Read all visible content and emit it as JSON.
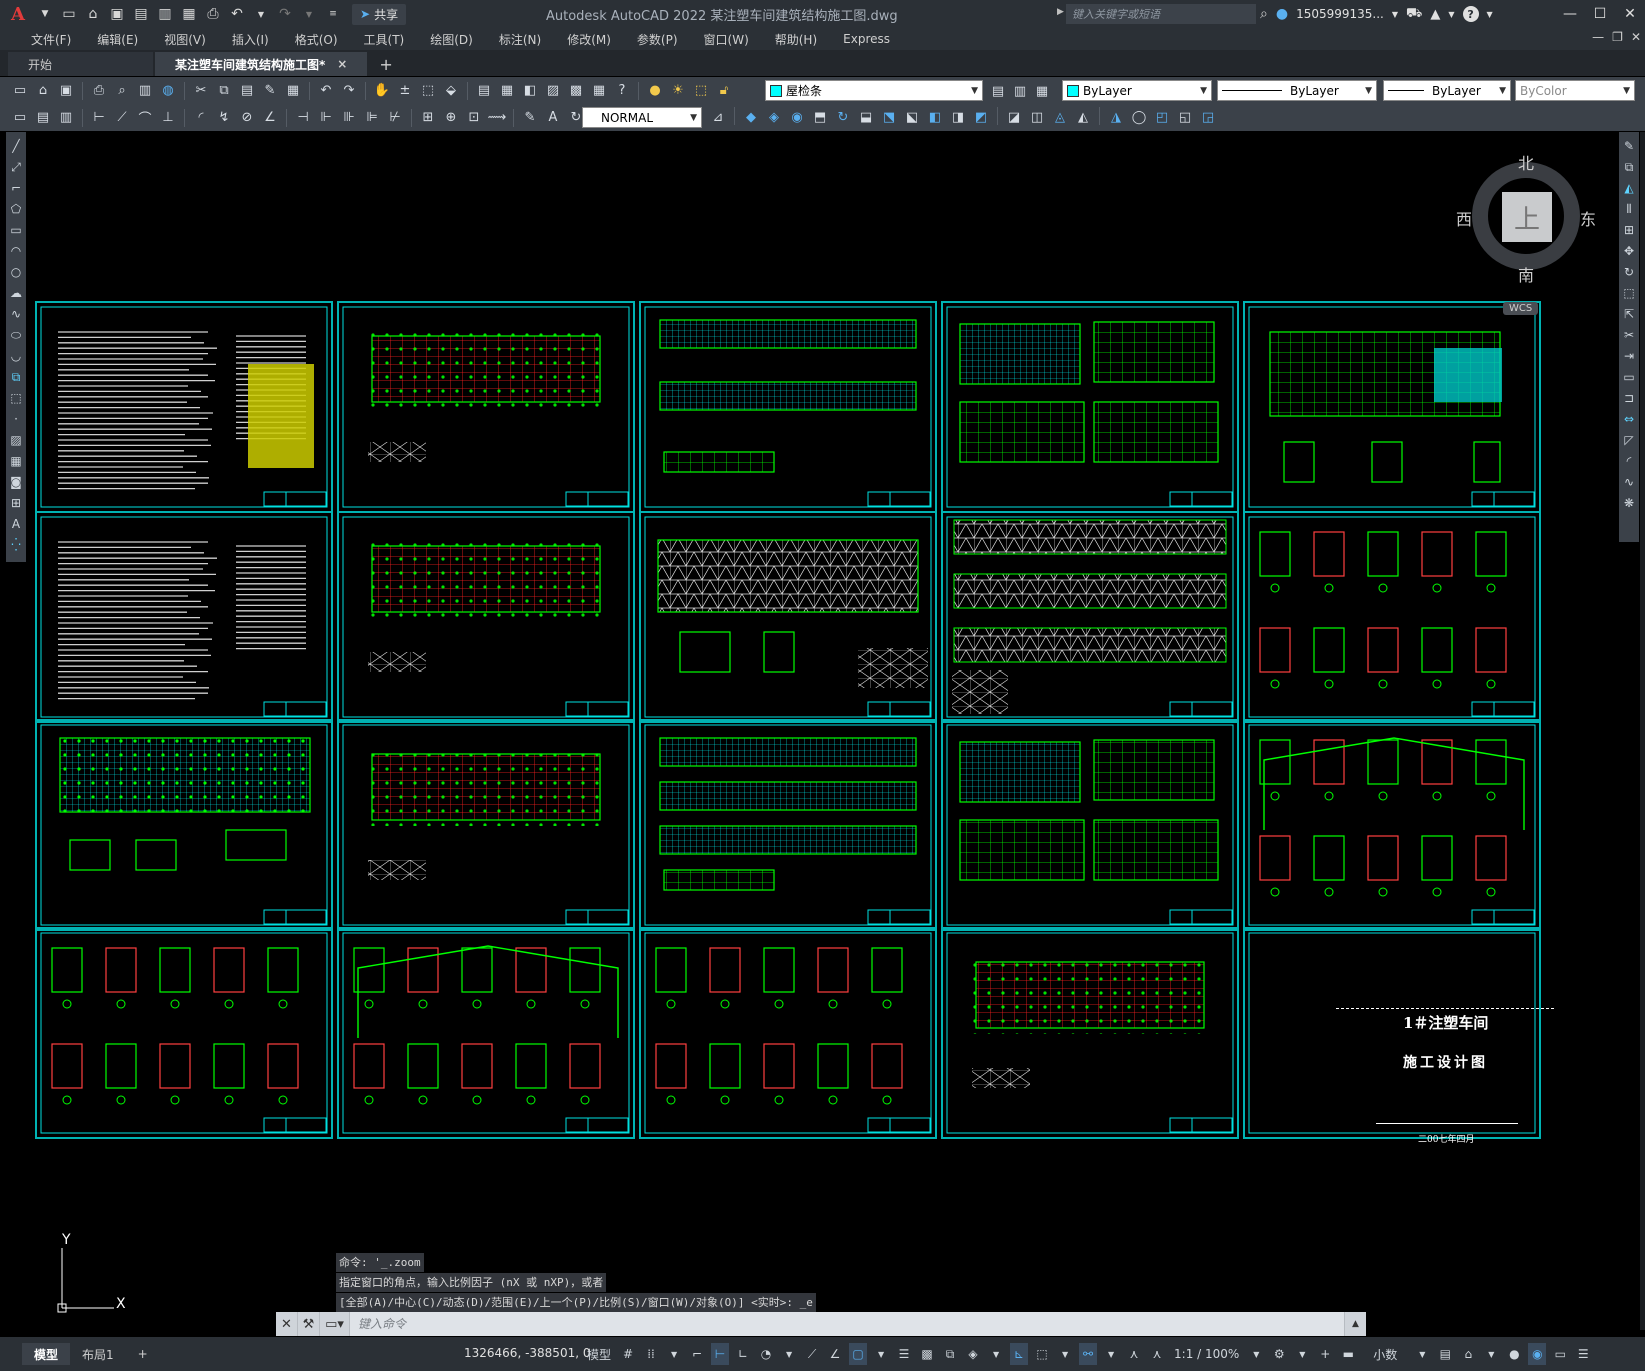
{
  "app": {
    "title": "Autodesk AutoCAD 2022    某注塑车间建筑结构施工图.dwg",
    "logo": "A",
    "share_label": "共享",
    "search_placeholder": "键入关键字或短语",
    "user_name": "1505999135...",
    "help_label": "?"
  },
  "menu": [
    "文件(F)",
    "编辑(E)",
    "视图(V)",
    "插入(I)",
    "格式(O)",
    "工具(T)",
    "绘图(D)",
    "标注(N)",
    "修改(M)",
    "参数(P)",
    "窗口(W)",
    "帮助(H)",
    "Express"
  ],
  "tabs": {
    "start": "开始",
    "active": "某注塑车间建筑结构施工图*",
    "close": "×",
    "add": "+"
  },
  "properties": {
    "layer": "屋检条",
    "color": "ByLayer",
    "linetype": "ByLayer",
    "lineweight": "ByLayer",
    "plotstyle": "ByColor",
    "textstyle": "NORMAL",
    "layer_color": "#00ffff"
  },
  "viewcube": {
    "north": "北",
    "south": "南",
    "west": "西",
    "east": "东",
    "face": "上",
    "wcs": "WCS"
  },
  "cover": {
    "title": "1＃注塑车间",
    "subtitle": "施工设计图",
    "date": "二00七年四月"
  },
  "ucs": {
    "x": "X",
    "y": "Y"
  },
  "command": {
    "history": [
      "命令: '_.zoom",
      "指定窗口的角点，输入比例因子 (nX 或 nXP)，或者",
      "[全部(A)/中心(C)/动态(D)/范围(E)/上一个(P)/比例(S)/窗口(W)/对象(O)] <实时>: _e"
    ],
    "placeholder": "键入命令"
  },
  "status": {
    "model_tab": "模型",
    "layout_tab": "布局1",
    "add": "+",
    "coords": "1326466, -388501, 0",
    "space": "模型",
    "scale": "1:1 / 100%",
    "units": "小数"
  },
  "colors": {
    "sheet_border": "#00b3b3",
    "drawing_green": "#00ff00",
    "drawing_red": "#ff2020",
    "drawing_cyan": "#00ffff"
  }
}
